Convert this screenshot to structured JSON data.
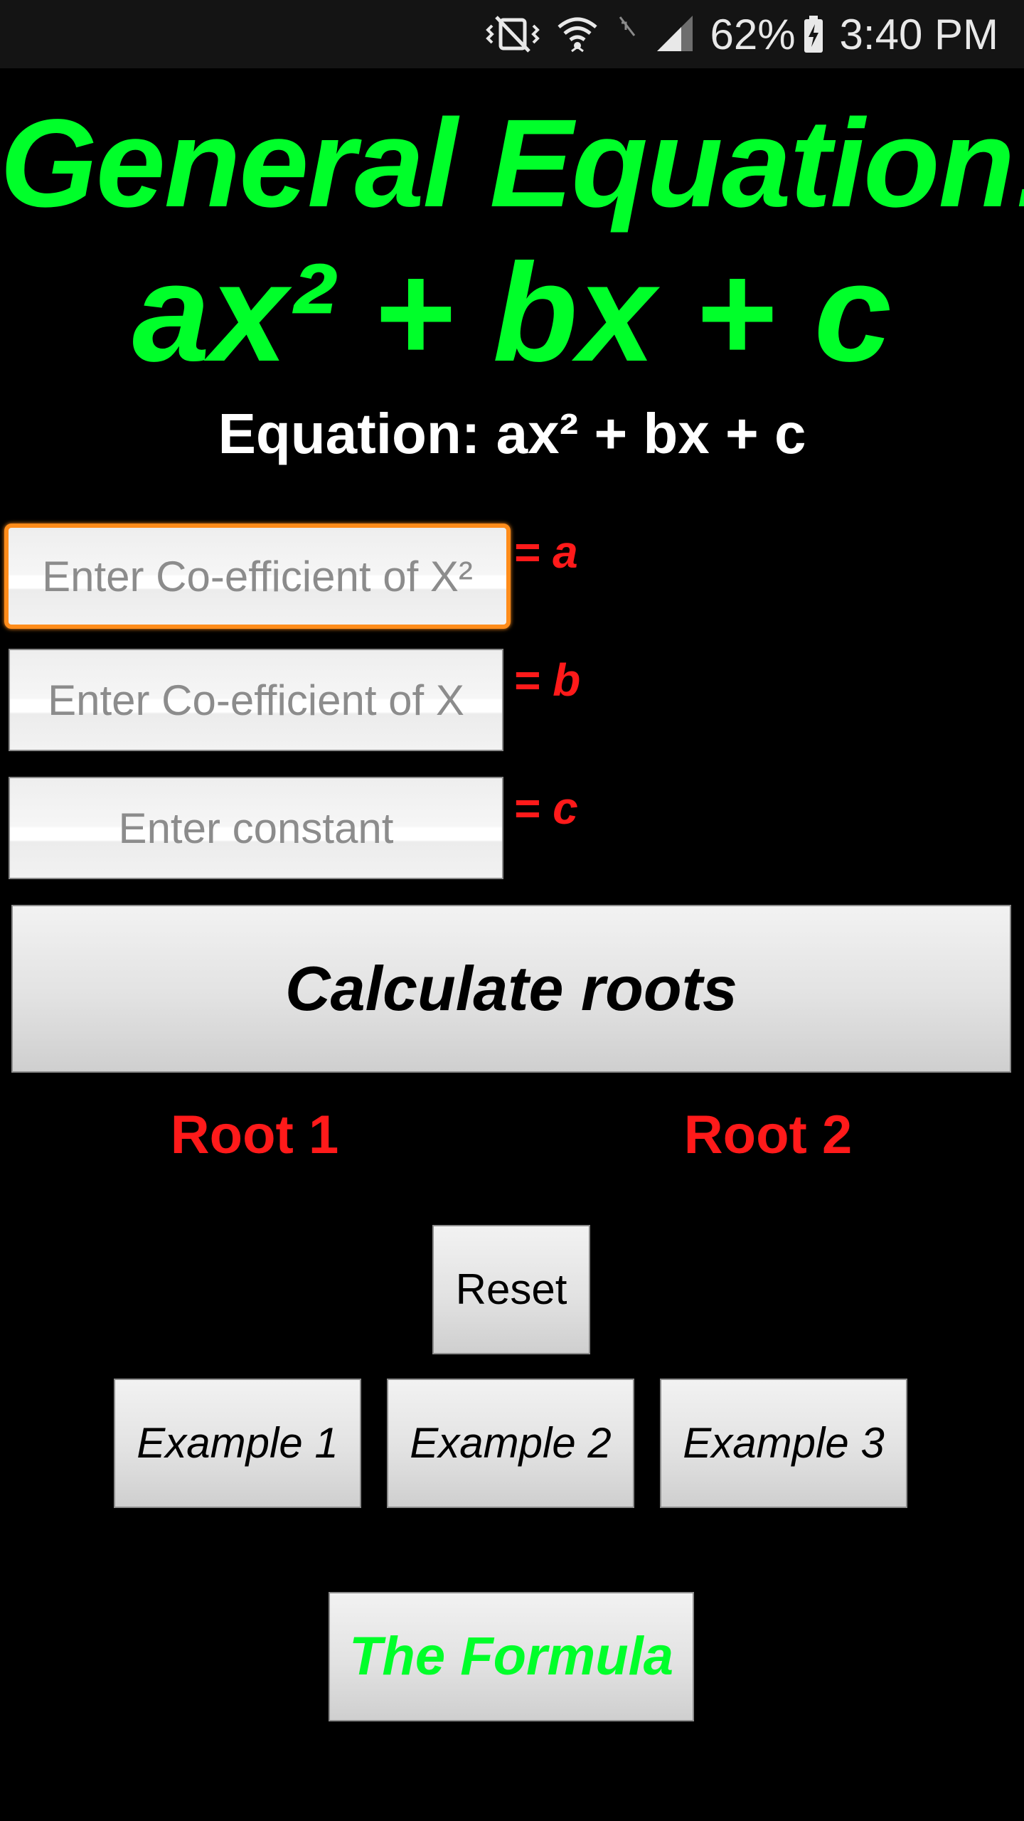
{
  "status_bar": {
    "battery": "62%",
    "time": "3:40 PM",
    "icons": [
      "mute-vibrate-icon",
      "wifi-icon",
      "no-signal-icon",
      "signal-icon",
      "battery-charging-icon"
    ]
  },
  "header": {
    "title_line1": "General Equation:",
    "title_line2": "ax² + bx + c",
    "subtitle": "Equation: ax² + bx + c"
  },
  "inputs": {
    "a": {
      "placeholder": "Enter Co-efficient of X²",
      "value": "",
      "label": "= a"
    },
    "b": {
      "placeholder": "Enter Co-efficient of X",
      "value": "",
      "label": "= b"
    },
    "c": {
      "placeholder": "Enter constant",
      "value": "",
      "label": "= c"
    }
  },
  "actions": {
    "calculate_label": "Calculate roots",
    "reset_label": "Reset",
    "example1_label": "Example 1",
    "example2_label": "Example 2",
    "example3_label": "Example 3",
    "formula_label": "The Formula"
  },
  "results": {
    "root1_label": "Root 1",
    "root2_label": "Root 2"
  },
  "colors": {
    "title": "#00ff2a",
    "label_red": "#ff1a1a",
    "focus_orange": "#ff8c1a",
    "background": "#000000"
  }
}
